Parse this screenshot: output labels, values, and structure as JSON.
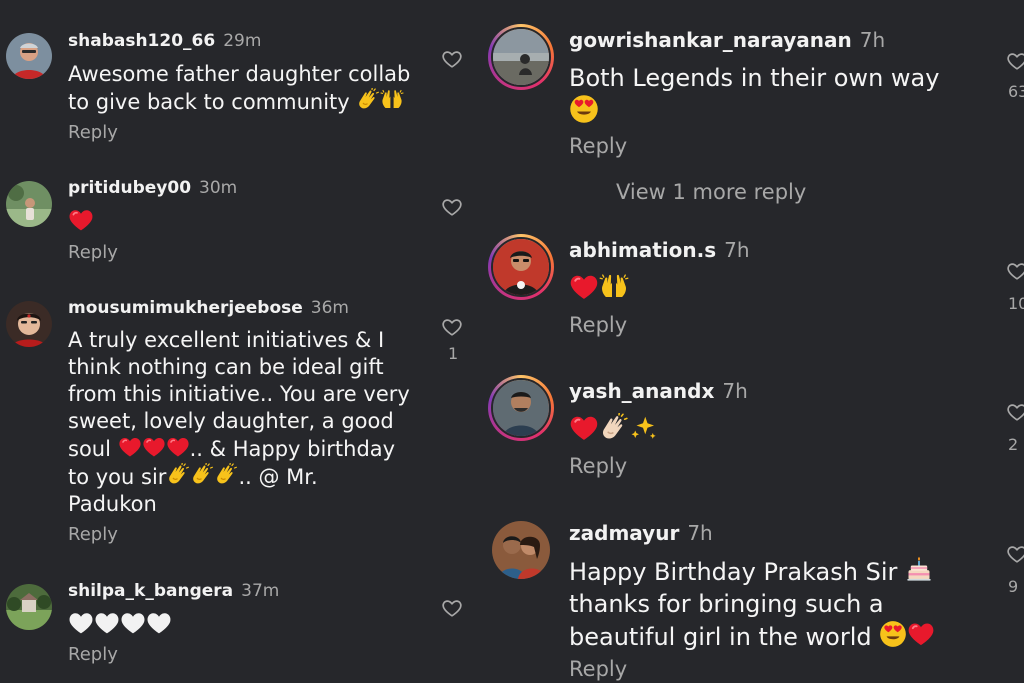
{
  "left_comments": [
    {
      "username": "shabash120_66",
      "time": "29m",
      "text_lines": [
        "Awesome father daughter collab",
        "to give back to community"
      ],
      "reply_label": "Reply"
    },
    {
      "username": "pritidubey00",
      "time": "30m",
      "reply_label": "Reply"
    },
    {
      "username": "mousumimukherjeebose",
      "time": "36m",
      "text_lines": [
        "A truly excellent initiatives & I",
        "think nothing can be ideal gift",
        "from this initiative.. You are very",
        "sweet, lovely daughter, a good",
        "soul",
        ".. &  Happy birthday",
        "to you sir",
        ".. @ Mr.",
        "Padukon"
      ],
      "like_count": "1",
      "reply_label": "Reply"
    },
    {
      "username": "shilpa_k_bangera",
      "time": "37m",
      "reply_label": "Reply"
    }
  ],
  "right_comments": [
    {
      "username": "gowrishankar_narayanan",
      "time": "7h",
      "text_lines": [
        "Both Legends in their own way"
      ],
      "like_count_partial": "63",
      "reply_label": "Reply"
    },
    {
      "username": "abhimation.s",
      "time": "7h",
      "like_count_partial": "10",
      "reply_label": "Reply"
    },
    {
      "username": "yash_anandx",
      "time": "7h",
      "like_count_partial": "2",
      "reply_label": "Reply"
    },
    {
      "username": "zadmayur",
      "time": "7h",
      "text_lines": [
        "Happy Birthday Prakash Sir",
        "thanks for bringing such a",
        "beautiful girl in the world"
      ],
      "like_count_partial": "9",
      "reply_label": "Reply"
    }
  ],
  "view_more_label": "View 1 more reply",
  "icons": {
    "like": "heart-outline-icon",
    "red_heart": "red-heart-emoji",
    "white_heart": "white-heart-emoji",
    "clap": "clapping-hands-emoji",
    "raised_hands": "raised-hands-emoji",
    "sparkles": "sparkles-emoji",
    "heart_eyes": "heart-eyes-emoji",
    "cake": "birthday-cake-emoji",
    "threads": "threads-icon"
  },
  "colors": {
    "background": "#26272b",
    "text_primary": "#f5f5f5",
    "text_secondary": "#a8a8a8",
    "heart_red": "#e8192c",
    "emoji_yellow": "#f7c21b"
  }
}
